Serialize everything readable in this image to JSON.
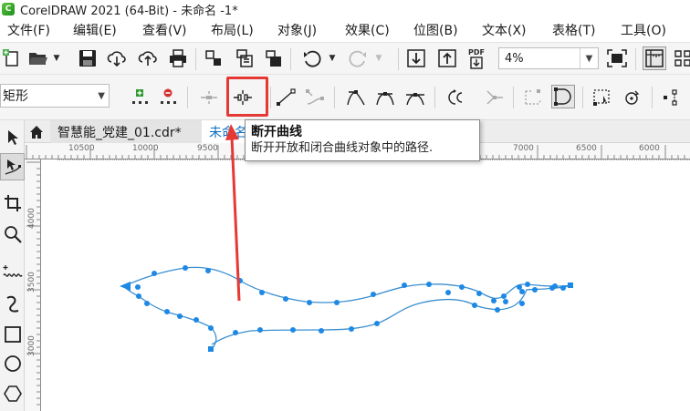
{
  "window": {
    "logo_letter": "C",
    "title": "CorelDRAW 2021 (64-Bit) - 未命名 -1*"
  },
  "menu": [
    {
      "label": "文件(F)"
    },
    {
      "label": "编辑(E)"
    },
    {
      "label": "查看(V)"
    },
    {
      "label": "布局(L)"
    },
    {
      "label": "对象(J)"
    },
    {
      "label": "效果(C)"
    },
    {
      "label": "位图(B)"
    },
    {
      "label": "文本(X)"
    },
    {
      "label": "表格(T)"
    },
    {
      "label": "工具(O)"
    }
  ],
  "toolbar": {
    "zoom_value": "4%",
    "pdf_label": "PDF",
    "icons": [
      "new-document-icon",
      "open-folder-icon",
      "save-icon",
      "cloud-download-icon",
      "cloud-upload-icon",
      "print-icon",
      "print-merge-icon",
      "publish-icon",
      "undo-icon",
      "redo-icon",
      "import-icon",
      "export-icon",
      "publish-pdf-icon",
      "full-screen-icon",
      "rulers-icon",
      "snap-icon"
    ]
  },
  "property_bar": {
    "shape_label": "矩形",
    "icons": [
      "add-node-icon",
      "delete-node-icon",
      "join-nodes-icon",
      "break-curve-icon",
      "to-line-icon",
      "to-curve-icon",
      "cusp-node-icon",
      "smooth-node-icon",
      "symmetric-node-icon",
      "reverse-direction-icon",
      "extend-curve-icon",
      "extract-subpath-icon",
      "close-curve-icon",
      "select-all-nodes-icon",
      "rotate-nodes-icon",
      "align-nodes-icon"
    ]
  },
  "tabs": [
    {
      "label": "智慧能_党建_01.cdr*"
    },
    {
      "label": "未命名 -1*"
    }
  ],
  "rulers": {
    "horizontal": [
      "10500",
      "10000",
      "9500",
      "7000",
      "6500",
      "6000"
    ],
    "vertical": [
      "4000",
      "3500",
      "3000"
    ]
  },
  "tooltip": {
    "title": "断开曲线",
    "description": "断开开放和闭合曲线对象中的路径."
  },
  "colors": {
    "accent": "#1e88e5",
    "highlight": "#e53935",
    "curve": "#3a8fd0"
  }
}
